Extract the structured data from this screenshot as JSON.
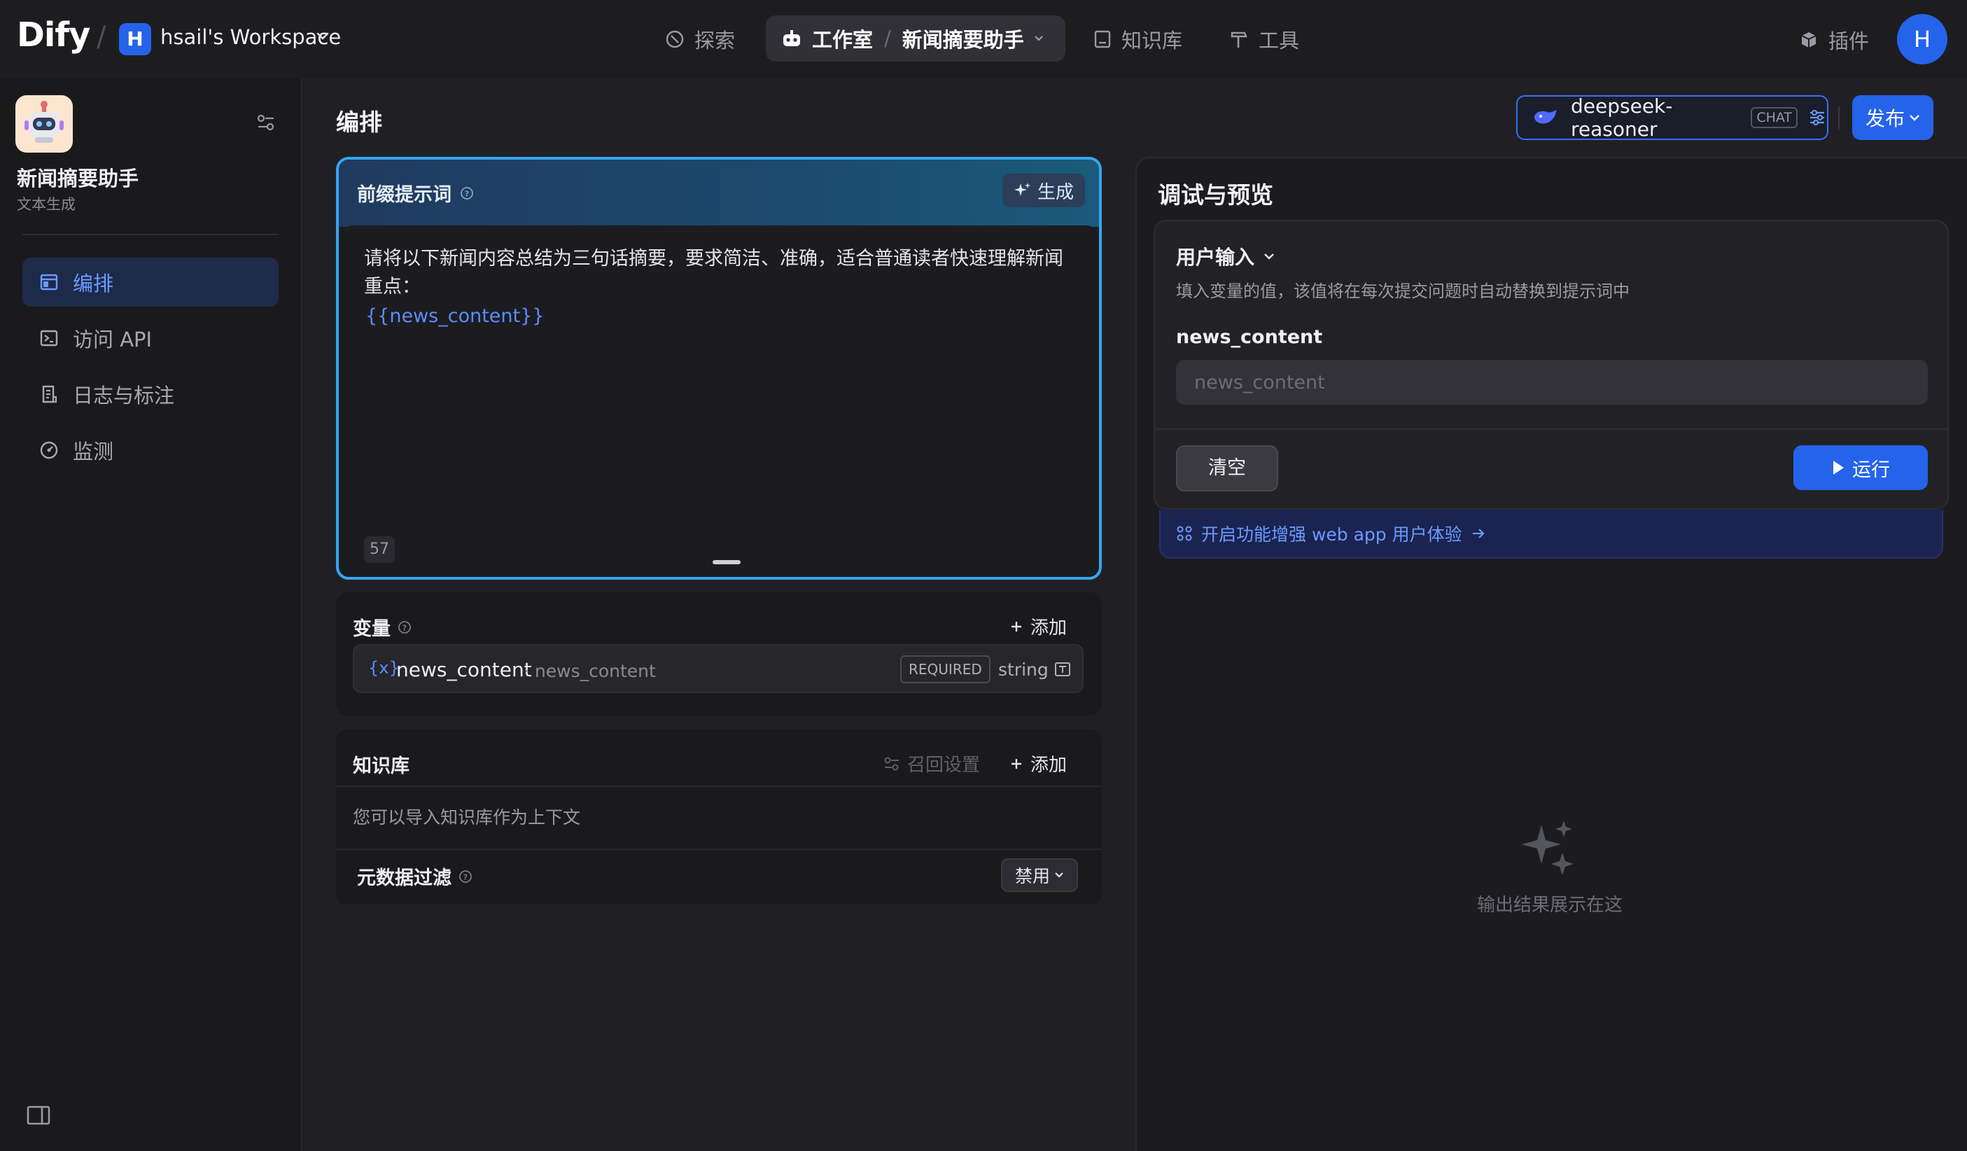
{
  "header": {
    "logo": "Dify",
    "workspace_initial": "H",
    "workspace_name": "hsail's Workspace",
    "nav": {
      "explore": "探索",
      "studio": "工作室",
      "current_app": "新闻摘要助手",
      "knowledge": "知识库",
      "tools": "工具",
      "plugins": "插件"
    },
    "user_initial": "H"
  },
  "sidebar": {
    "app_name": "新闻摘要助手",
    "app_type": "文本生成",
    "items": [
      {
        "label": "编排",
        "icon": "layout-icon",
        "active": true
      },
      {
        "label": "访问 API",
        "icon": "terminal-icon",
        "active": false
      },
      {
        "label": "日志与标注",
        "icon": "document-icon",
        "active": false
      },
      {
        "label": "监测",
        "icon": "dashboard-icon",
        "active": false
      }
    ]
  },
  "main": {
    "title": "编排",
    "model": {
      "name": "deepseek-reasoner",
      "mode": "CHAT"
    },
    "publish_label": "发布",
    "prompt": {
      "label": "前缀提示词",
      "generate_label": "生成",
      "text": "请将以下新闻内容总结为三句话摘要，要求简洁、准确，适合普通读者快速理解新闻重点：",
      "variable": "{{news_content}}",
      "char_count": "57"
    },
    "variables": {
      "title": "变量",
      "add_label": "添加",
      "items": [
        {
          "icon": "{x}",
          "key": "news_content",
          "label": "· news_content",
          "required": "REQUIRED",
          "type": "string"
        }
      ]
    },
    "knowledge": {
      "title": "知识库",
      "recall_label": "召回设置",
      "add_label": "添加",
      "hint": "您可以导入知识库作为上下文",
      "metadata_label": "元数据过滤",
      "metadata_value": "禁用"
    }
  },
  "debug": {
    "title": "调试与预览",
    "user_input_title": "用户输入",
    "user_input_desc": "填入变量的值，该值将在每次提交问题时自动替换到提示词中",
    "field_label": "news_content",
    "field_placeholder": "news_content",
    "field_value": "",
    "clear_label": "清空",
    "run_label": "运行",
    "enhance_text": "开启功能增强 web app 用户体验",
    "empty_text": "输出结果展示在这"
  },
  "colors": {
    "accent": "#2563eb",
    "link": "#6b9bff",
    "prompt_border": "#38a4f0",
    "background": "#1d1d20"
  }
}
